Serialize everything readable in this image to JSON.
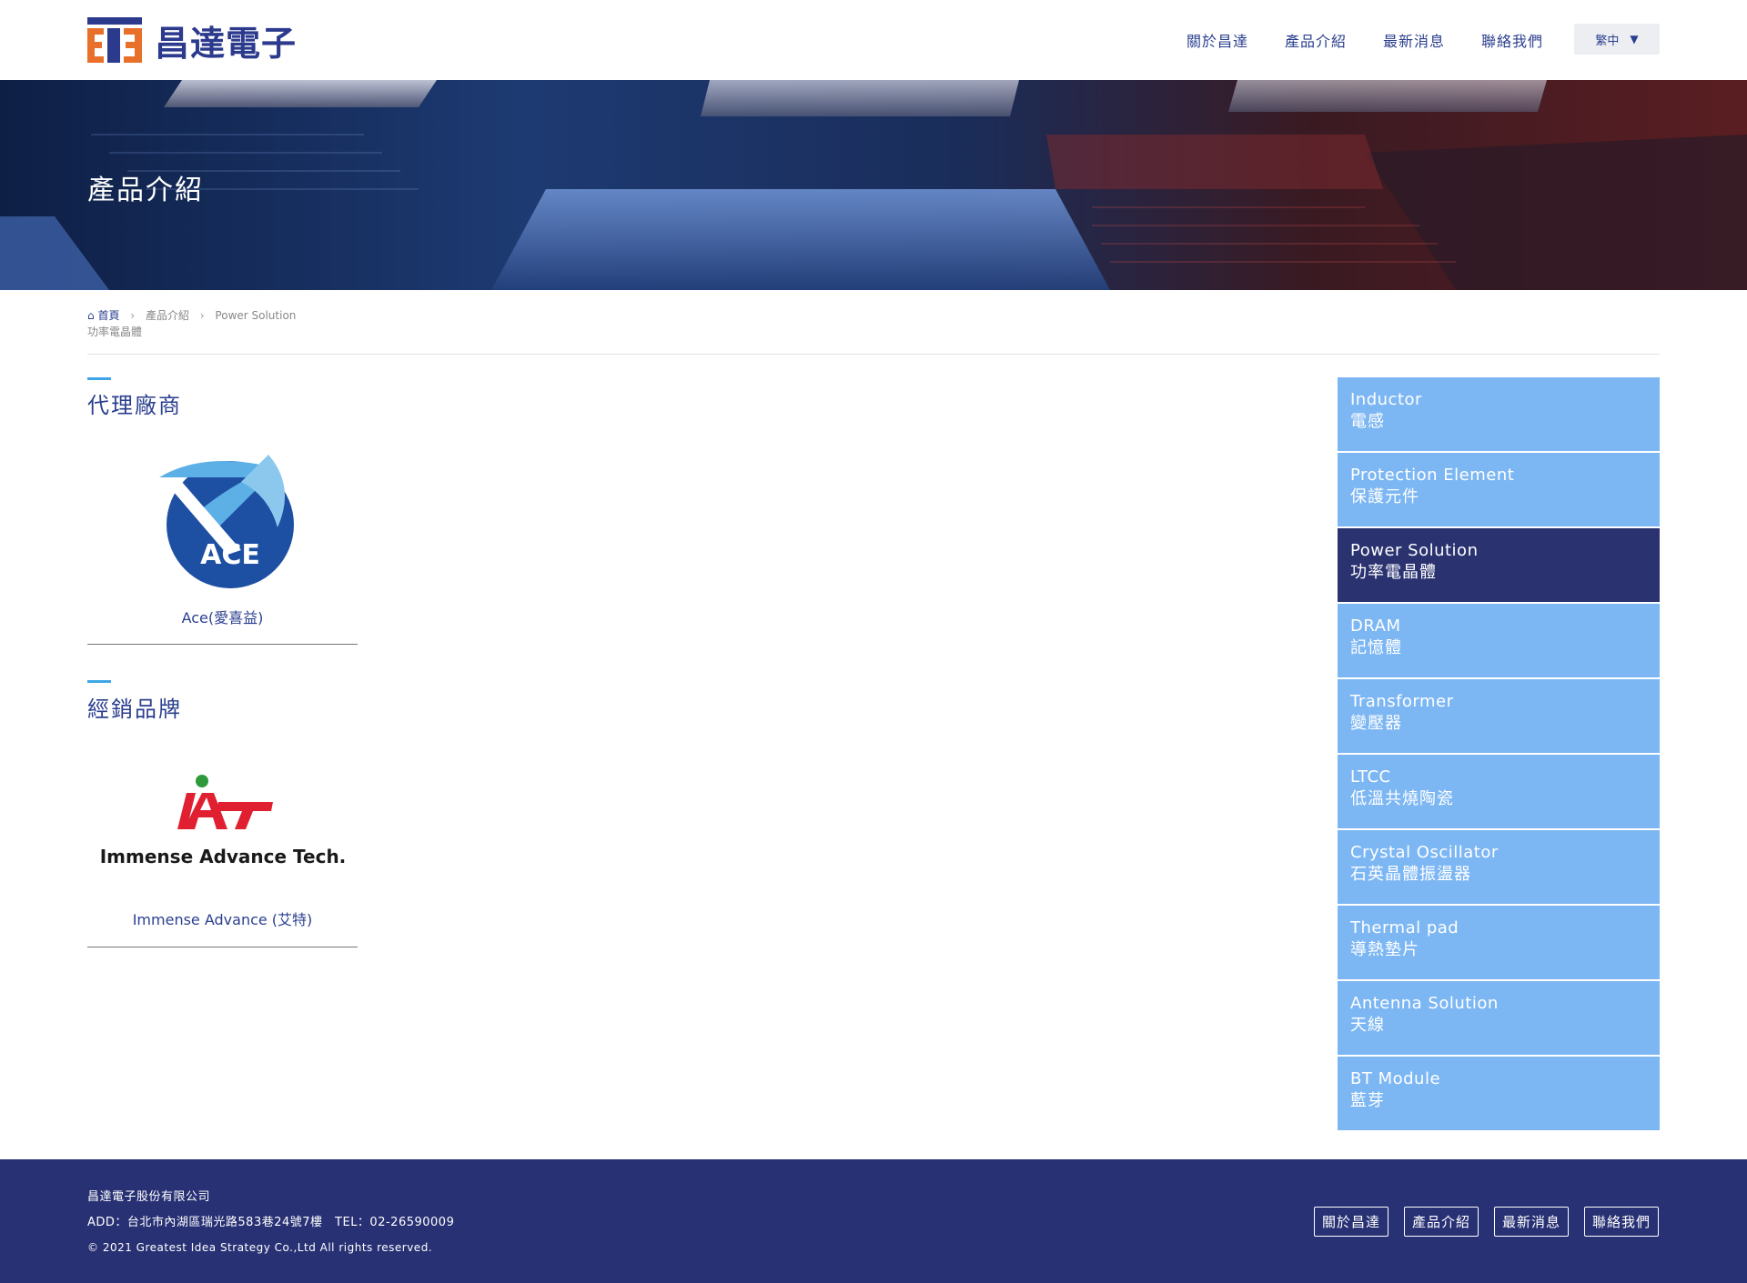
{
  "header": {
    "logo_text": "昌達電子",
    "nav": [
      "關於昌達",
      "產品介紹",
      "最新消息",
      "聯絡我們"
    ],
    "language": "繁中"
  },
  "banner": {
    "title": "產品介紹"
  },
  "breadcrumb": {
    "home": "首頁",
    "level1": "產品介紹",
    "level2": "Power Solution",
    "level3": "功率電晶體"
  },
  "sections": {
    "agent_title": "代理廠商",
    "dist_title": "經銷品牌"
  },
  "brands": {
    "agent": {
      "name": "Ace(愛喜益)",
      "logo_text": "ACE"
    },
    "distributor": {
      "name": "Immense Advance (艾特)",
      "logo_text": "Immense Advance Tech."
    }
  },
  "sidebar": {
    "items": [
      {
        "en": "Inductor",
        "zh": "電感"
      },
      {
        "en": "Protection Element",
        "zh": "保護元件"
      },
      {
        "en": "Power Solution",
        "zh": "功率電晶體"
      },
      {
        "en": "DRAM",
        "zh": "記憶體"
      },
      {
        "en": "Transformer",
        "zh": "變壓器"
      },
      {
        "en": "LTCC",
        "zh": "低溫共燒陶瓷"
      },
      {
        "en": "Crystal Oscillator",
        "zh": "石英晶體振盪器"
      },
      {
        "en": "Thermal pad",
        "zh": "導熱墊片"
      },
      {
        "en": "Antenna Solution",
        "zh": "天線"
      },
      {
        "en": "BT Module",
        "zh": "藍芽"
      }
    ],
    "active_index": 2
  },
  "footer": {
    "company": "昌達電子股份有限公司",
    "address": "ADD：台北市內湖區瑞光路583巷24號7樓　TEL：02-26590009",
    "copyright": "© 2021 Greatest Idea Strategy Co.,Ltd All rights reserved.",
    "links": [
      "關於昌達",
      "產品介紹",
      "最新消息",
      "聯絡我們"
    ]
  },
  "colors": {
    "brand_blue": "#2b3f8f",
    "sidebar_item": "#7db7f3",
    "sidebar_active": "#2a3270",
    "footer_bg": "#283174",
    "accent_bar": "#3ea6e6",
    "logo_orange": "#e8702a"
  }
}
